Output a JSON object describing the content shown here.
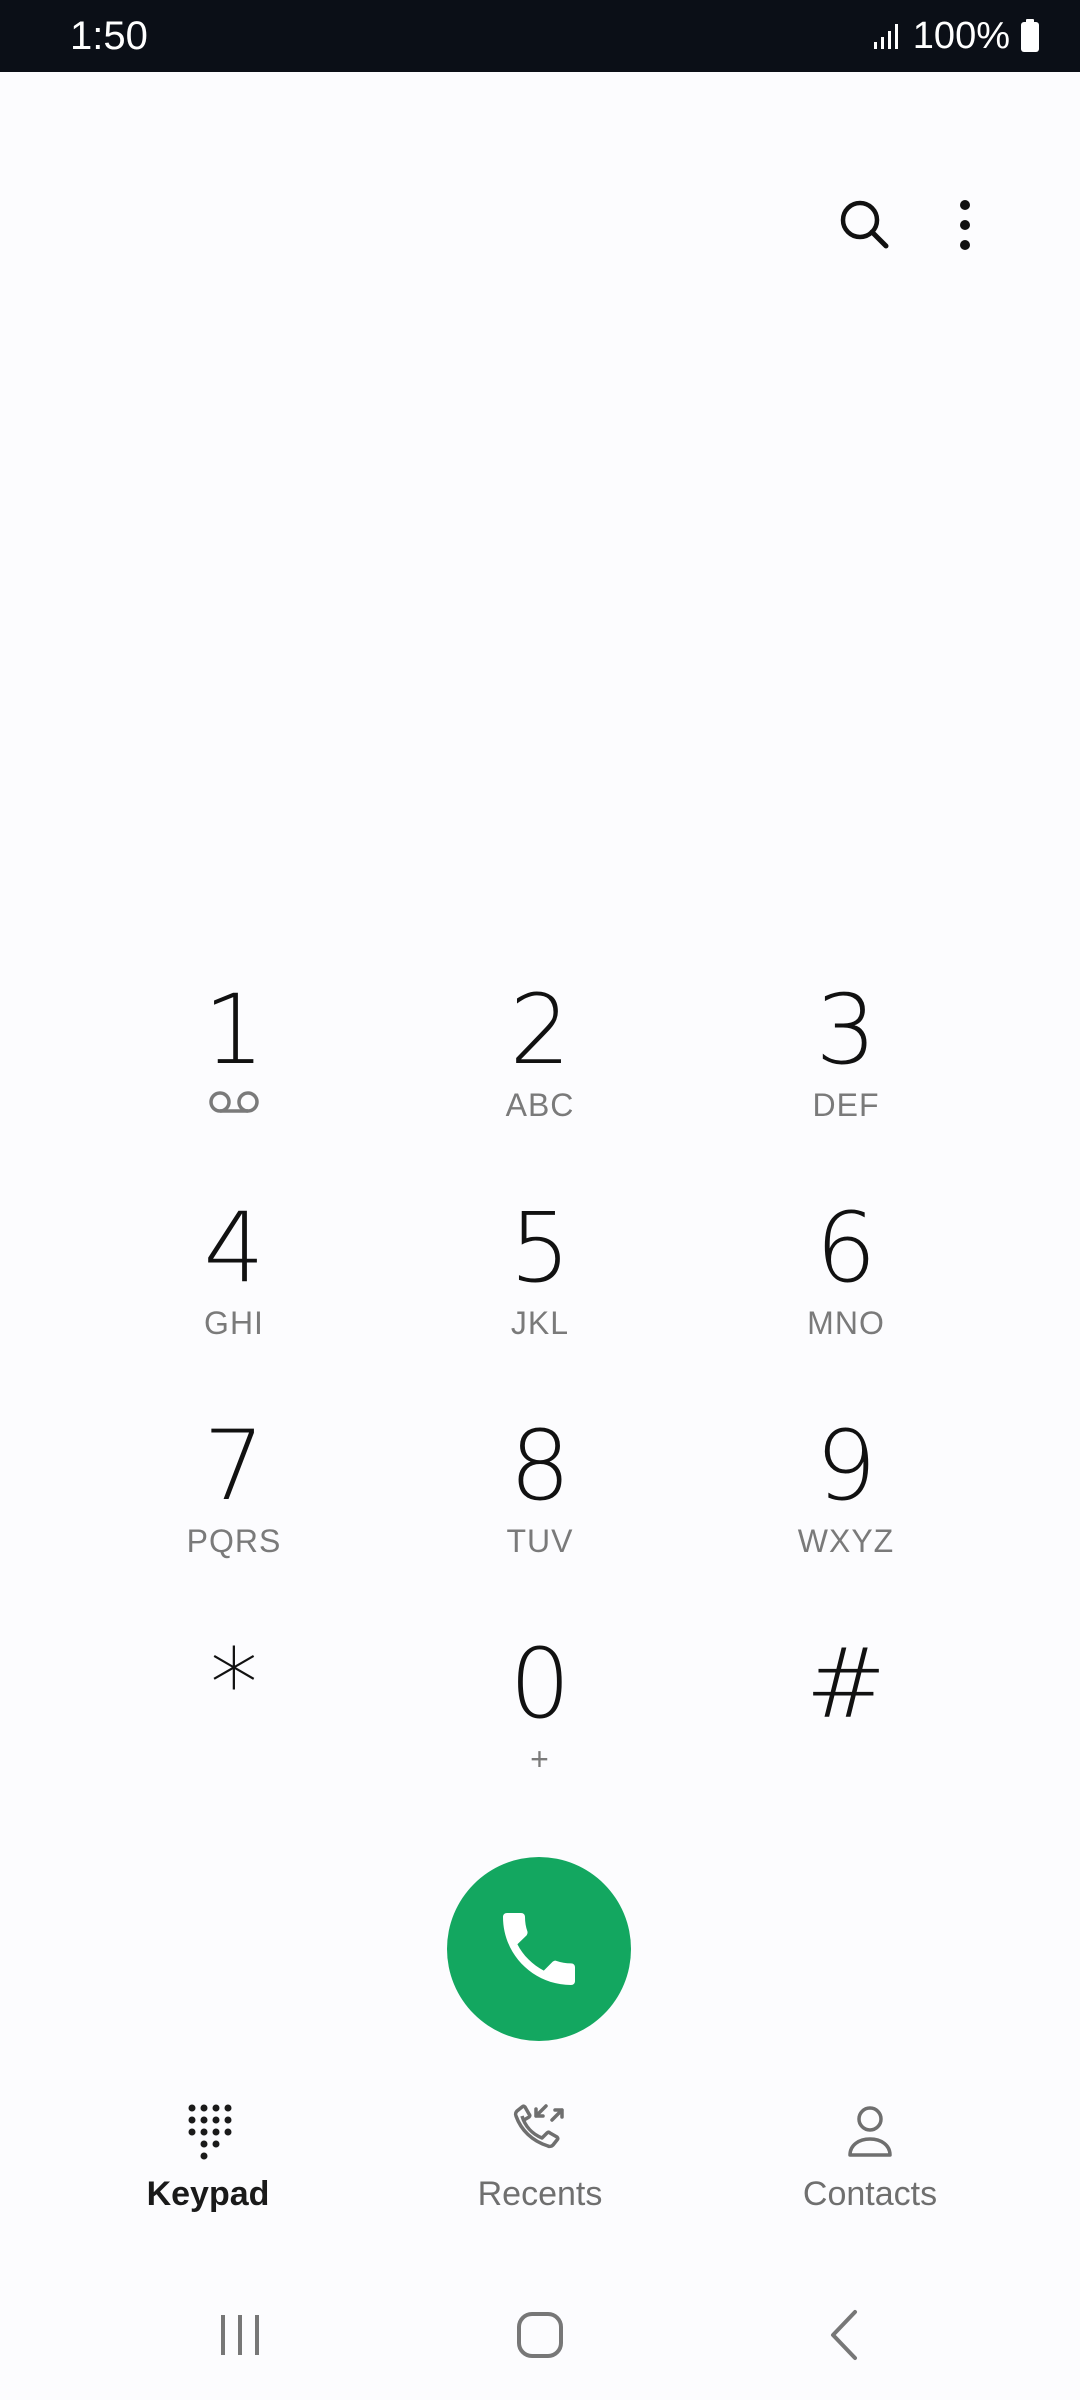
{
  "status_bar": {
    "time": "1:50",
    "battery": "100%",
    "signal_icon": "signal-bars-icon",
    "battery_icon": "battery-full-icon"
  },
  "top_actions": {
    "search_icon": "search-icon",
    "more_icon": "more-vertical-icon"
  },
  "keypad": {
    "keys": [
      {
        "digit": "1",
        "letters": "",
        "icon": "voicemail-icon"
      },
      {
        "digit": "2",
        "letters": "ABC"
      },
      {
        "digit": "3",
        "letters": "DEF"
      },
      {
        "digit": "4",
        "letters": "GHI"
      },
      {
        "digit": "5",
        "letters": "JKL"
      },
      {
        "digit": "6",
        "letters": "MNO"
      },
      {
        "digit": "7",
        "letters": "PQRS"
      },
      {
        "digit": "8",
        "letters": "TUV"
      },
      {
        "digit": "9",
        "letters": "WXYZ"
      },
      {
        "digit": "*",
        "letters": ""
      },
      {
        "digit": "0",
        "letters": "+"
      },
      {
        "digit": "#",
        "letters": ""
      }
    ]
  },
  "call_button": {
    "icon": "phone-icon",
    "color": "#13a760"
  },
  "bottom_nav": {
    "tabs": [
      {
        "label": "Keypad",
        "icon": "keypad-grid-icon",
        "active": true
      },
      {
        "label": "Recents",
        "icon": "recent-calls-icon",
        "active": false
      },
      {
        "label": "Contacts",
        "icon": "person-icon",
        "active": false
      }
    ]
  },
  "system_nav": {
    "recents_icon": "recent-apps-icon",
    "home_icon": "home-icon",
    "back_icon": "back-icon"
  }
}
